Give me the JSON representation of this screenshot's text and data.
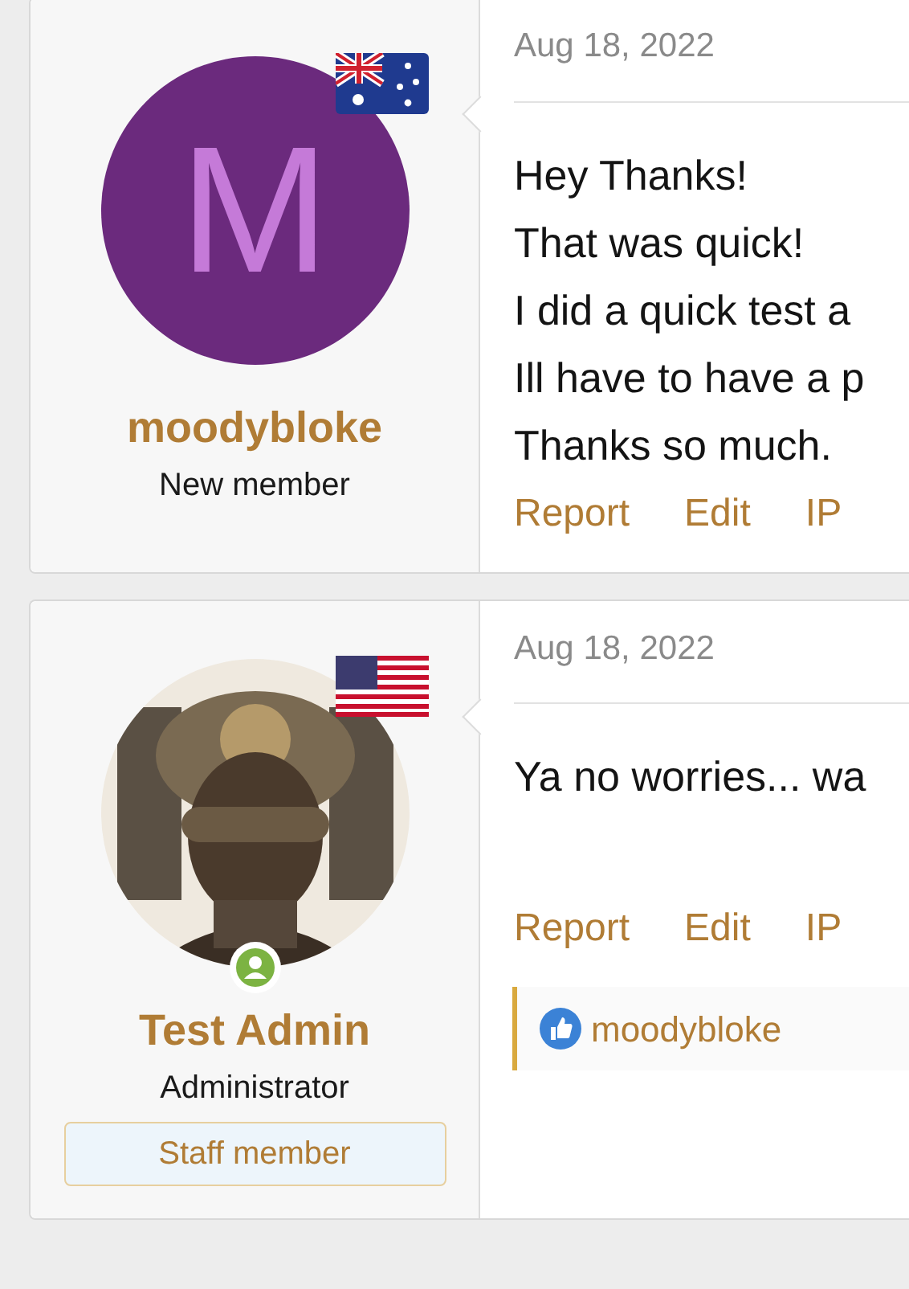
{
  "posts": [
    {
      "author": {
        "name": "moodybloke",
        "title": "New member",
        "avatar": {
          "kind": "letter",
          "letter": "M"
        },
        "flag": {
          "kind": "au"
        },
        "online": false
      },
      "date": "Aug 18, 2022",
      "lines": [
        "Hey Thanks!",
        "That was quick!",
        "I did a quick test a",
        "Ill have to have a p",
        "Thanks so much."
      ],
      "actions": [
        "Report",
        "Edit",
        "IP"
      ]
    },
    {
      "author": {
        "name": "Test Admin",
        "title": "Administrator",
        "flag": {
          "kind": "us"
        },
        "online": true,
        "badge": "Staff member"
      },
      "date": "Aug 18, 2022",
      "lines": [
        "Ya no worries... wa"
      ],
      "actions": [
        "Report",
        "Edit",
        "IP"
      ],
      "reactions": "moodybloke"
    }
  ]
}
